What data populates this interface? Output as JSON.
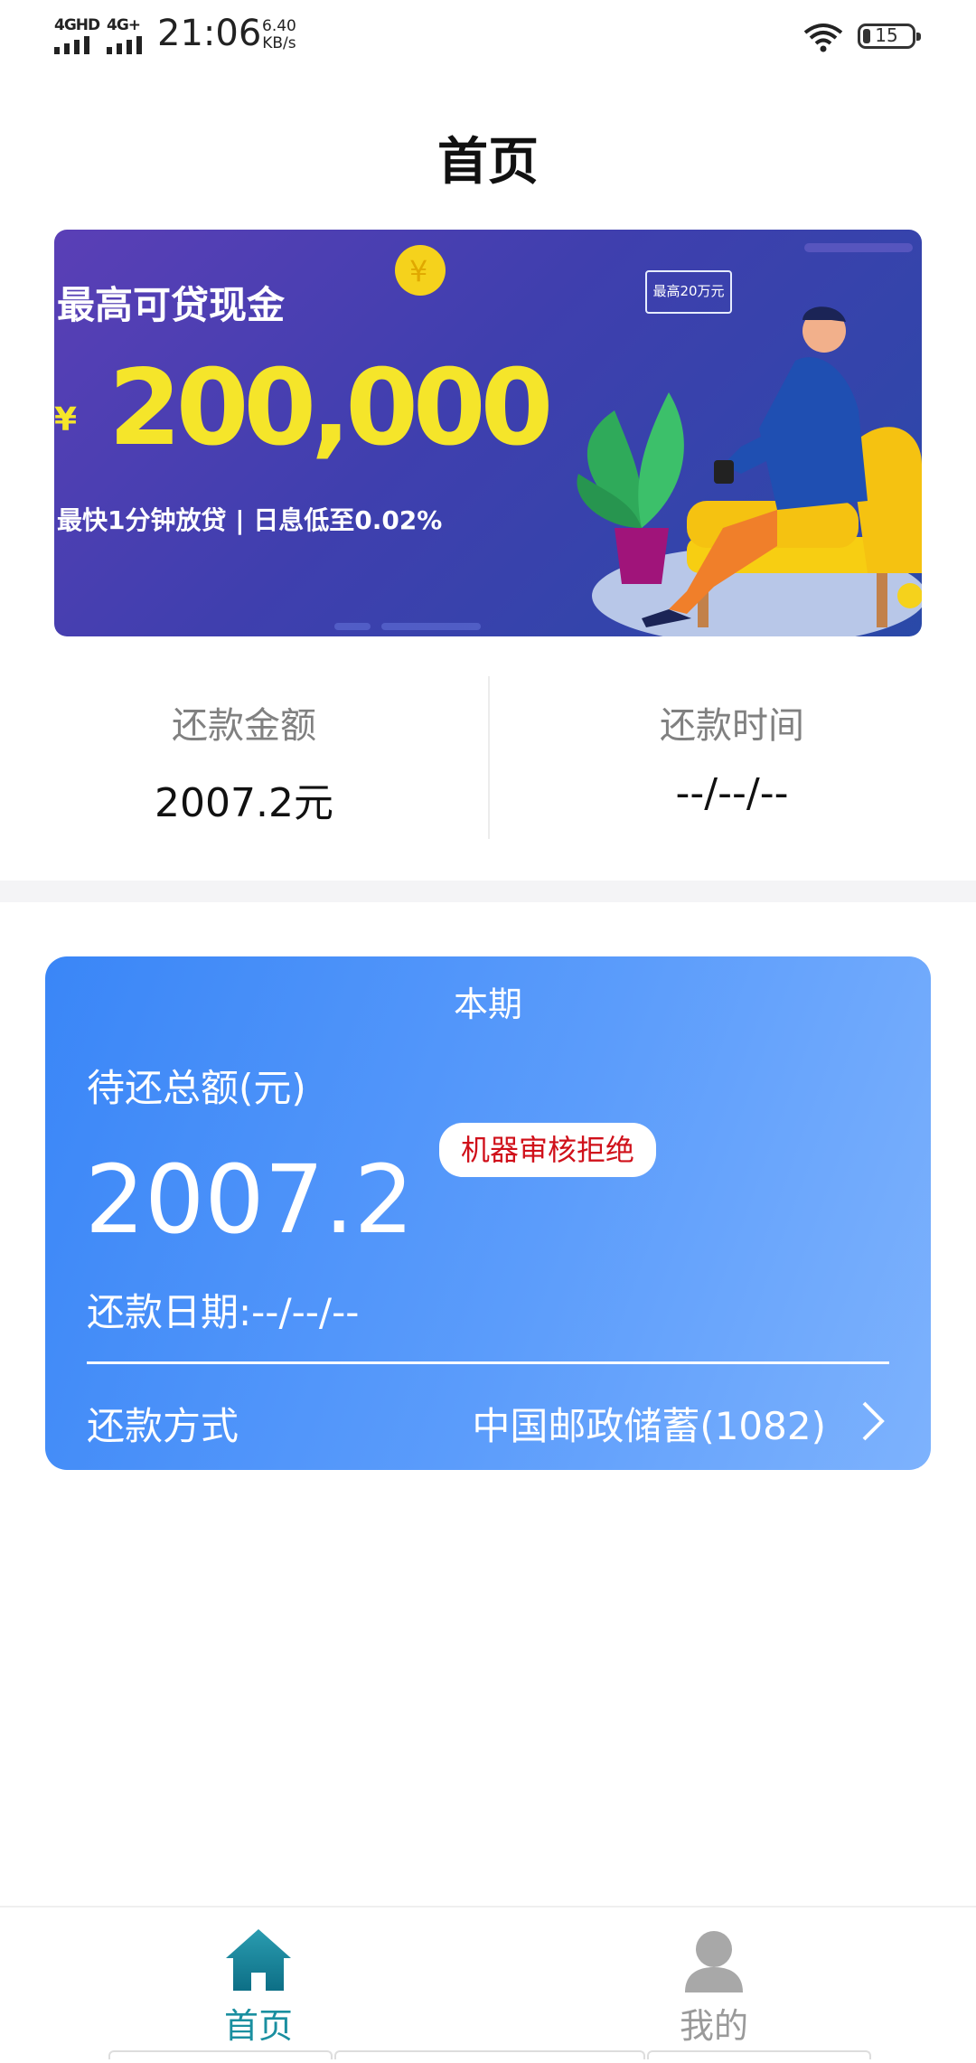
{
  "status_bar": {
    "signal1_label": "4GHD",
    "signal2_label": "4G+",
    "time": "21:06",
    "net_speed_value": "6.40",
    "net_speed_unit": "KB/s",
    "battery_level": "15"
  },
  "header": {
    "title": "首页"
  },
  "banner": {
    "title": "最高可贷现金",
    "currency": "¥",
    "amount": "200,000",
    "subtitle": "最快1分钟放贷 | 日息低至0.02%",
    "bubble_text": "最高20万元"
  },
  "summary": {
    "left_label": "还款金额",
    "left_value": "2007.2元",
    "right_label": "还款时间",
    "right_value": "--/--/--"
  },
  "card": {
    "period_label": "本期",
    "due_label": "待还总额(元)",
    "amount": "2007.2",
    "status_badge": "机器审核拒绝",
    "date_text": "还款日期:--/--/--",
    "method_label": "还款方式",
    "method_value": "中国邮政储蓄(1082)"
  },
  "tabbar": {
    "home_label": "首页",
    "mine_label": "我的",
    "active_color": "#1a8fa0",
    "inactive_color": "#9a9a9a"
  }
}
